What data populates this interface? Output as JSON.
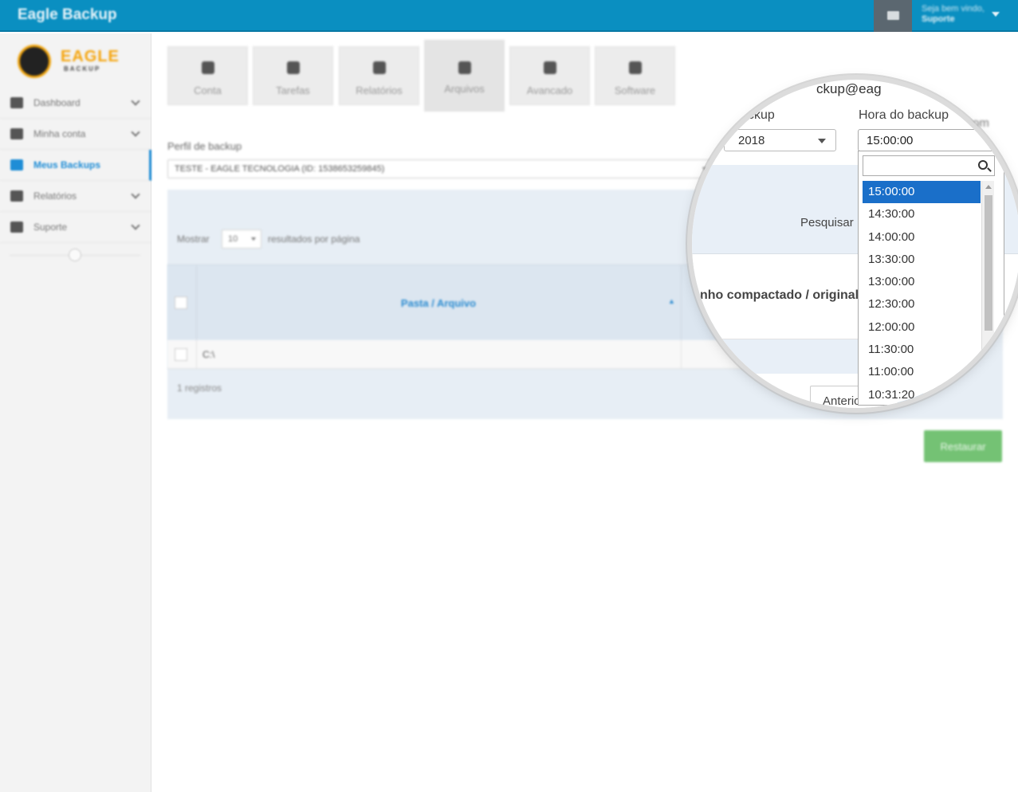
{
  "header": {
    "app_title": "Eagle Backup",
    "welcome": "Seja bem vindo,",
    "user": "Suporte"
  },
  "sidebar": {
    "logo_text": "EAGLE",
    "logo_sub": "BACKUP",
    "items": [
      {
        "label": "Dashboard",
        "icon": "dashboard-icon"
      },
      {
        "label": "Minha conta",
        "icon": "user-icon"
      },
      {
        "label": "Meus Backups",
        "icon": "list-icon",
        "active": true
      },
      {
        "label": "Relatórios",
        "icon": "chart-icon"
      },
      {
        "label": "Suporte",
        "icon": "lifebuoy-icon"
      }
    ]
  },
  "tabs": [
    {
      "label": "Conta",
      "icon": "user-icon"
    },
    {
      "label": "Tarefas",
      "icon": "edit-icon"
    },
    {
      "label": "Relatórios",
      "icon": "report-icon"
    },
    {
      "label": "Arquivos",
      "icon": "cloud-icon",
      "active": true
    },
    {
      "label": "Avancado",
      "icon": "wrench-icon"
    },
    {
      "label": "Software",
      "icon": "binoculars-icon"
    }
  ],
  "profile": {
    "label": "Perfil de backup",
    "value": "TESTE - EAGLE TECNOLOGIA  (ID: 1538653259845)"
  },
  "table": {
    "show_label": "Mostrar",
    "page_size": "10",
    "per_page_label": "resultados por página",
    "column": "Pasta / Arquivo",
    "rows": [
      "C:\\"
    ],
    "records": "1 registros"
  },
  "restore_label": "Restaurar",
  "background_email_fragment": "a.com",
  "magnifier": {
    "email_fragment": "ckup@eag",
    "date_label": "ckup",
    "time_label": "Hora do backup",
    "date_value": "2018",
    "time_value": "15:00:00",
    "search_label": "Pesquisar",
    "column_label": "nho compactado / original",
    "prev_label": "Anterior",
    "time_options": [
      "15:00:00",
      "14:30:00",
      "14:00:00",
      "13:30:00",
      "13:00:00",
      "12:30:00",
      "12:00:00",
      "11:30:00",
      "11:00:00",
      "10:31:20"
    ],
    "selected_index": 0
  },
  "colors": {
    "topbar": "#0a8fc1",
    "accent": "#1f8dd6",
    "selected_option": "#1a6fc9",
    "restore_button": "#5cb85c"
  }
}
